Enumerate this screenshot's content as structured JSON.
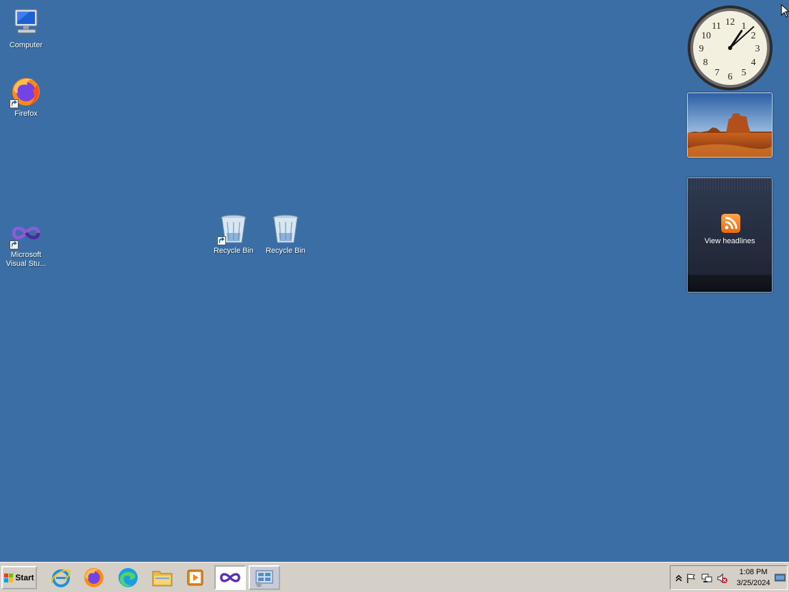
{
  "desktop": {
    "background_color": "#3a6ea5",
    "icons": [
      {
        "label": "Computer",
        "icon": "computer-icon"
      },
      {
        "label": "Firefox",
        "icon": "firefox-icon"
      },
      {
        "label": "Microsoft Visual Stu...",
        "icon": "visual-studio-icon"
      },
      {
        "label": "Recycle Bin",
        "icon": "recycle-bin-icon"
      },
      {
        "label": "Recycle Bin",
        "icon": "recycle-bin-icon"
      }
    ]
  },
  "gadgets": {
    "clock": {
      "hour": 1,
      "minute": 8
    },
    "slideshow": {
      "icon": "desert-landscape-image"
    },
    "feed": {
      "label": "View headlines",
      "icon": "rss-feed-icon"
    }
  },
  "taskbar": {
    "start_label": "Start",
    "buttons": [
      {
        "name": "internet-explorer",
        "icon": "internet-explorer-icon"
      },
      {
        "name": "firefox",
        "icon": "firefox-icon"
      },
      {
        "name": "edge",
        "icon": "edge-icon"
      },
      {
        "name": "file-explorer",
        "icon": "folder-icon"
      },
      {
        "name": "media-player",
        "icon": "media-player-icon"
      },
      {
        "name": "visual-studio",
        "icon": "visual-studio-icon"
      },
      {
        "name": "server-manager",
        "icon": "server-manager-icon"
      }
    ],
    "tray": {
      "icons": [
        "show-hidden-icon",
        "action-center-flag-icon",
        "network-icon",
        "volume-muted-icon"
      ],
      "time": "1:08 PM",
      "date": "3/25/2024"
    }
  }
}
